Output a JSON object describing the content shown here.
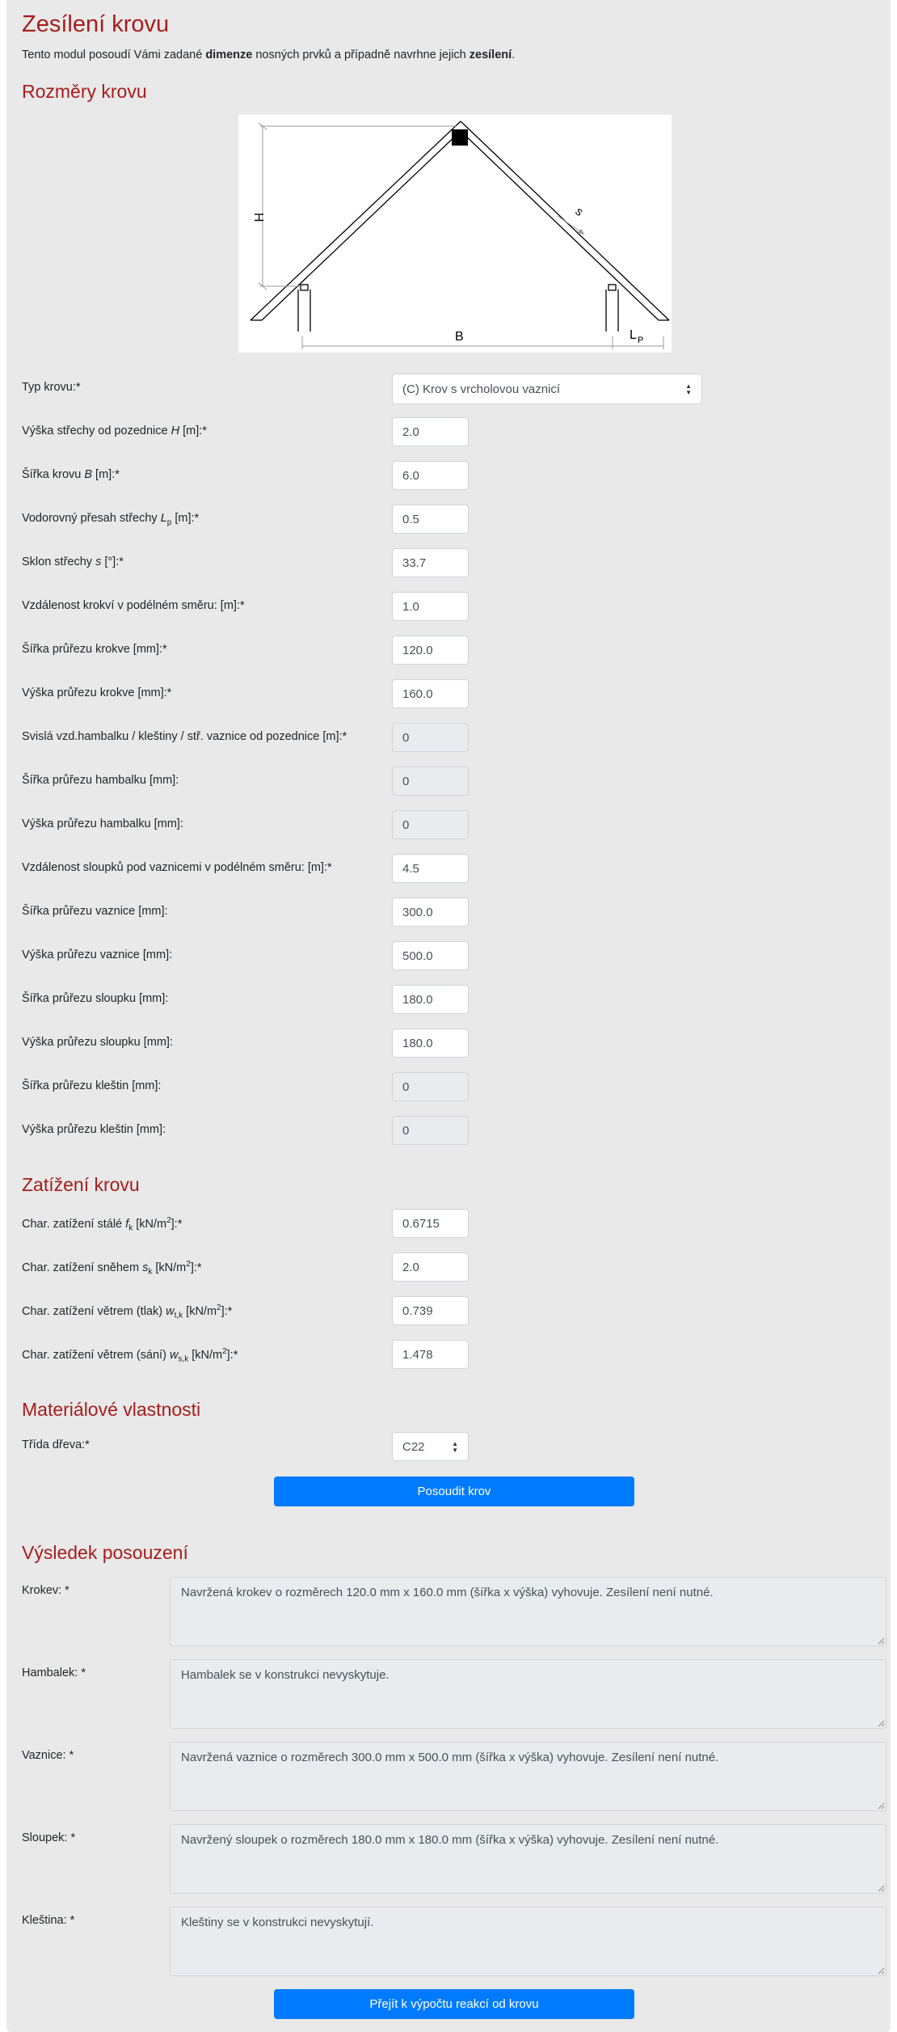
{
  "header": {
    "title": "Zesílení krovu",
    "intro_prefix": "Tento modul posoudí Vámi zadané ",
    "intro_bold1": "dimenze",
    "intro_middle": " nosných prvků a případně navrhne jejich ",
    "intro_bold2": "zesílení",
    "intro_suffix": "."
  },
  "dimensions": {
    "heading": "Rozměry krovu",
    "diagram": {
      "h": "H",
      "b": "B",
      "s": "s",
      "lp": "L",
      "lp_sub": "P"
    },
    "roof_type_label": "Typ krovu:*",
    "roof_type_value": "(C) Krov s vrcholovou vaznicí",
    "fields": [
      {
        "pre": "Výška střechy od pozednice ",
        "var": "H",
        "sub": "",
        "sup": "",
        "post": " [m]:*",
        "value": "2.0",
        "disabled": false
      },
      {
        "pre": "Šířka krovu ",
        "var": "B",
        "sub": "",
        "sup": "",
        "post": " [m]:*",
        "value": "6.0",
        "disabled": false
      },
      {
        "pre": "Vodorovný přesah střechy ",
        "var": "L",
        "sub": "p",
        "sup": "",
        "post": " [m]:*",
        "value": "0.5",
        "disabled": false
      },
      {
        "pre": "Sklon střechy ",
        "var": "s",
        "sub": "",
        "sup": "",
        "post": " [°]:*",
        "value": "33.7",
        "disabled": false
      },
      {
        "pre": "Vzdálenost krokví v podélném směru: [m]:*",
        "var": "",
        "sub": "",
        "sup": "",
        "post": "",
        "value": "1.0",
        "disabled": false
      },
      {
        "pre": "Šířka průřezu krokve [mm]:*",
        "var": "",
        "sub": "",
        "sup": "",
        "post": "",
        "value": "120.0",
        "disabled": false
      },
      {
        "pre": "Výška průřezu krokve [mm]:*",
        "var": "",
        "sub": "",
        "sup": "",
        "post": "",
        "value": "160.0",
        "disabled": false
      },
      {
        "pre": "Svislá vzd.hambalku / kleštiny / stř. vaznice od pozednice [m]:*",
        "var": "",
        "sub": "",
        "sup": "",
        "post": "",
        "value": "0",
        "disabled": true
      },
      {
        "pre": "Šířka průřezu hambalku [mm]:",
        "var": "",
        "sub": "",
        "sup": "",
        "post": "",
        "value": "0",
        "disabled": true
      },
      {
        "pre": "Výška průřezu hambalku [mm]:",
        "var": "",
        "sub": "",
        "sup": "",
        "post": "",
        "value": "0",
        "disabled": true
      },
      {
        "pre": "Vzdálenost sloupků pod vaznicemi v podélném směru: [m]:*",
        "var": "",
        "sub": "",
        "sup": "",
        "post": "",
        "value": "4.5",
        "disabled": false
      },
      {
        "pre": "Šířka průřezu vaznice [mm]:",
        "var": "",
        "sub": "",
        "sup": "",
        "post": "",
        "value": "300.0",
        "disabled": false
      },
      {
        "pre": "Výška průřezu vaznice [mm]:",
        "var": "",
        "sub": "",
        "sup": "",
        "post": "",
        "value": "500.0",
        "disabled": false
      },
      {
        "pre": "Šířka průřezu sloupku [mm]:",
        "var": "",
        "sub": "",
        "sup": "",
        "post": "",
        "value": "180.0",
        "disabled": false
      },
      {
        "pre": "Výška průřezu sloupku [mm]:",
        "var": "",
        "sub": "",
        "sup": "",
        "post": "",
        "value": "180.0",
        "disabled": false
      },
      {
        "pre": "Šířka průřezu kleštin [mm]:",
        "var": "",
        "sub": "",
        "sup": "",
        "post": "",
        "value": "0",
        "disabled": true
      },
      {
        "pre": "Výška průřezu kleštin [mm]:",
        "var": "",
        "sub": "",
        "sup": "",
        "post": "",
        "value": "0",
        "disabled": true
      }
    ]
  },
  "loads": {
    "heading": "Zatížení krovu",
    "fields": [
      {
        "pre": "Char. zatížení stálé ",
        "var": "f",
        "sub": "k",
        "sup": "",
        "post": " [kN/m",
        "sup2": "2",
        "post2": "]:*",
        "value": "0.6715"
      },
      {
        "pre": "Char. zatížení sněhem ",
        "var": "s",
        "sub": "k",
        "sup": "",
        "post": " [kN/m",
        "sup2": "2",
        "post2": "]:*",
        "value": "2.0"
      },
      {
        "pre": "Char. zatížení větrem (tlak) ",
        "var": "w",
        "sub": "t,k",
        "sup": "",
        "post": " [kN/m",
        "sup2": "2",
        "post2": "]:*",
        "value": "0.739"
      },
      {
        "pre": "Char. zatížení větrem (sání) ",
        "var": "w",
        "sub": "s,k",
        "sup": "",
        "post": " [kN/m",
        "sup2": "2",
        "post2": "]:*",
        "value": "1.478"
      }
    ]
  },
  "material": {
    "heading": "Materiálové vlastnosti",
    "wood_class_label": "Třída dřeva:*",
    "wood_class_value": "C22",
    "submit_label": "Posoudit krov"
  },
  "results": {
    "heading": "Výsledek posouzení",
    "items": [
      {
        "label": "Krokev: *",
        "text": "Navržená krokev o rozměrech 120.0 mm x 160.0 mm (šířka x výška) vyhovuje. Zesílení není nutné."
      },
      {
        "label": "Hambalek: *",
        "text": "Hambalek se v konstrukci nevyskytuje."
      },
      {
        "label": "Vaznice: *",
        "text": "Navržená vaznice o rozměrech 300.0 mm x 500.0 mm (šířka x výška) vyhovuje. Zesílení není nutné."
      },
      {
        "label": "Sloupek: *",
        "text": "Navržený sloupek o rozměrech 180.0 mm x 180.0 mm (šířka x výška) vyhovuje. Zesílení není nutné."
      },
      {
        "label": "Kleština: *",
        "text": "Kleštiny se v konstrukci nevyskytují."
      }
    ],
    "next_label": "Přejít k výpočtu reakcí od krovu"
  }
}
